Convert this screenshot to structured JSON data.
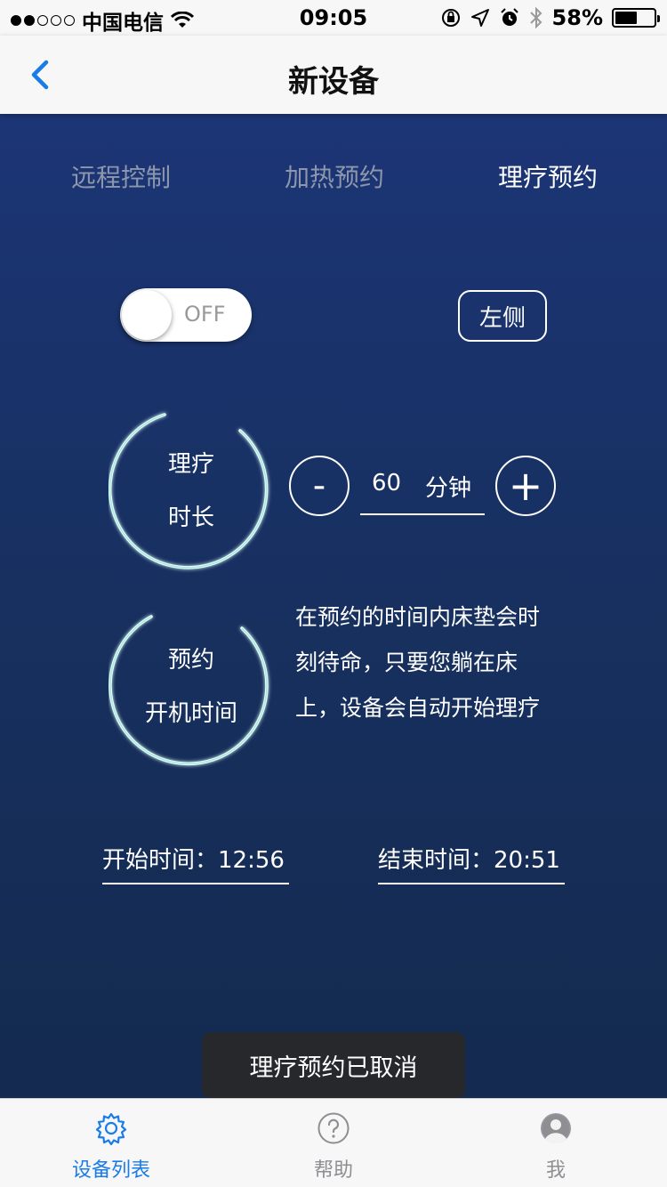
{
  "status_bar": {
    "carrier": "中国电信",
    "time": "09:05",
    "battery_percent": "58%",
    "battery_level": 0.58,
    "icons": [
      "signal-dots-icon",
      "wifi-icon",
      "rotation-lock-icon",
      "location-icon",
      "alarm-icon",
      "bluetooth-icon",
      "battery-icon"
    ]
  },
  "nav": {
    "title": "新设备",
    "back_icon": "chevron-left-icon"
  },
  "tabs": [
    {
      "label": "远程控制",
      "active": false
    },
    {
      "label": "加热预约",
      "active": false
    },
    {
      "label": "理疗预约",
      "active": true
    }
  ],
  "controls": {
    "toggle_label": "OFF",
    "toggle_on": false,
    "side_button": "左侧"
  },
  "duration": {
    "ring_line1": "理疗",
    "ring_line2": "时长",
    "minus": "-",
    "plus": "+",
    "value": "60",
    "unit": "分钟"
  },
  "schedule": {
    "ring_line1": "预约",
    "ring_line2": "开机时间",
    "description_lines": [
      "在预约的时间内床垫会时",
      "刻待命，只要您躺在床",
      "上，设备会自动开始理疗"
    ]
  },
  "times": {
    "start": "开始时间：12:56",
    "end": "结束时间：20:51"
  },
  "toast": "理疗预约已取消",
  "tab_bar": [
    {
      "label": "设备列表",
      "icon": "gear-icon",
      "active": true
    },
    {
      "label": "帮助",
      "icon": "help-icon",
      "active": false
    },
    {
      "label": "我",
      "icon": "user-icon",
      "active": false
    }
  ],
  "colors": {
    "accent": "#1a7ce8",
    "panel_top": "#1c3576",
    "panel_bottom": "#142a4f",
    "ring_glow": "#7fe0d6"
  }
}
